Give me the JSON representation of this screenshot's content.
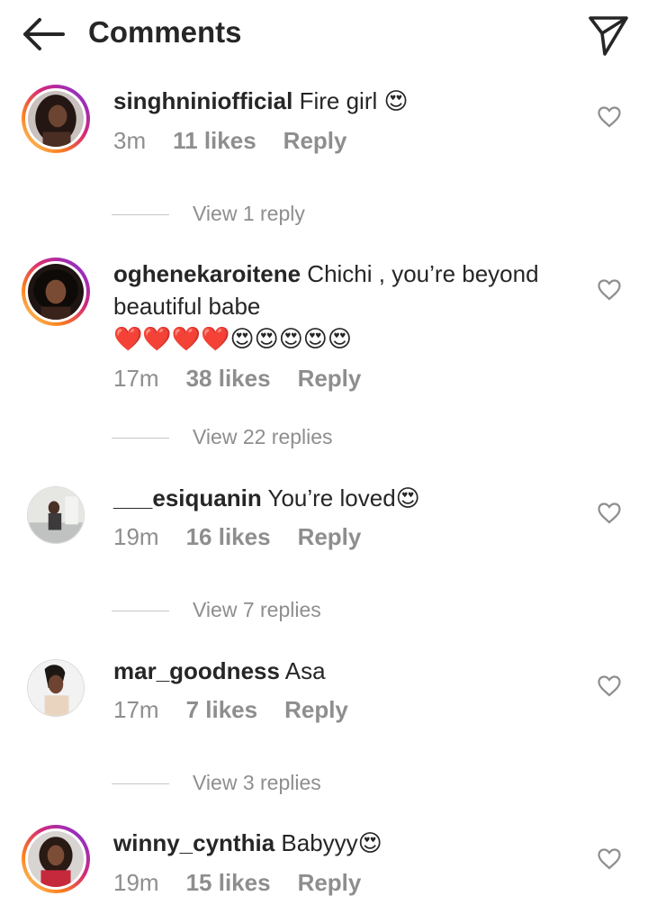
{
  "header": {
    "title": "Comments",
    "back_icon": "arrow-left-icon",
    "share_icon": "paper-plane-icon"
  },
  "comments": [
    {
      "username": "singhniniofficial",
      "text": "Fire girl",
      "emoji": "😍",
      "time": "3m",
      "likes": "11 likes",
      "reply": "Reply",
      "view_replies": "View 1 reply",
      "story_ring": true
    },
    {
      "username": "oghenekaroitene",
      "text": "Chichi , you’re beyond beautiful babe",
      "emoji": "❤️❤️❤️❤️😍😍😍😍😍",
      "time": "17m",
      "likes": "38 likes",
      "reply": "Reply",
      "view_replies": "View 22 replies",
      "story_ring": true
    },
    {
      "username": "___esiquanin",
      "text": "You’re loved",
      "emoji": "😍",
      "time": "19m",
      "likes": "16 likes",
      "reply": "Reply",
      "view_replies": "View 7 replies",
      "story_ring": false
    },
    {
      "username": "mar_goodness",
      "text": "Asa",
      "emoji": "",
      "time": "17m",
      "likes": "7 likes",
      "reply": "Reply",
      "view_replies": "View 3 replies",
      "story_ring": false
    },
    {
      "username": "winny_cynthia",
      "text": "Babyyy",
      "emoji": "😍",
      "time": "19m",
      "likes": "15 likes",
      "reply": "Reply",
      "view_replies": "",
      "story_ring": true
    }
  ],
  "colors": {
    "text": "#262626",
    "muted": "#8e8e8e",
    "background": "#ffffff"
  }
}
